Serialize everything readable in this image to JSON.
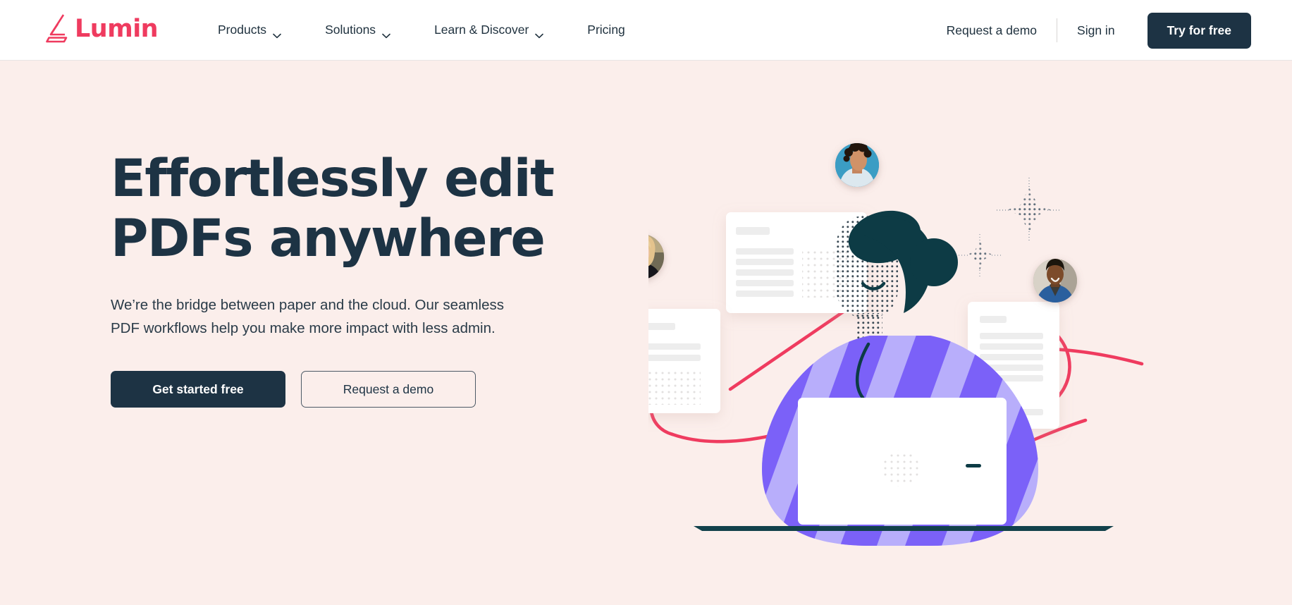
{
  "navbar": {
    "brand": {
      "name": "Lumin",
      "icon": "lumin-logo-mark",
      "color": "#ef3b5f"
    },
    "links": [
      {
        "label": "Products",
        "has_dropdown": true,
        "icon": "chevron-down-icon"
      },
      {
        "label": "Solutions",
        "has_dropdown": true,
        "icon": "chevron-down-icon"
      },
      {
        "label": "Learn & Discover",
        "has_dropdown": true,
        "icon": "chevron-down-icon"
      },
      {
        "label": "Pricing",
        "has_dropdown": false,
        "icon": ""
      }
    ],
    "request_demo_label": "Request a demo",
    "sign_in_label": "Sign in",
    "try_free_label": "Try for free"
  },
  "hero": {
    "title_line1": "Effortlessly edit",
    "title_line2": "PDFs anywhere",
    "subtitle": "We’re the bridge between paper and the cloud. Our seamless PDF workflows help you make more impact with less admin.",
    "primary_cta": "Get started free",
    "secondary_cta": "Request a demo",
    "background_color": "#fbeeeb",
    "text_color": "#1d3344"
  },
  "illustration": {
    "alt": "Person at laptop surrounded by floating PDF documents and collaborator avatars connected by pink lines",
    "accent_line_color": "#ef3b5f",
    "dark_color": "#0d3b45",
    "sweater_colors": [
      "#7b61f8",
      "#b8aefb"
    ],
    "documents": [
      {
        "name": "document-card-top",
        "orientation": "landscape"
      },
      {
        "name": "document-card-left",
        "orientation": "portrait"
      },
      {
        "name": "document-card-right",
        "orientation": "portrait"
      }
    ],
    "avatars": [
      {
        "name": "avatar-top",
        "background": "#3b9dc4"
      },
      {
        "name": "avatar-left",
        "background": "#8a7f6e"
      },
      {
        "name": "avatar-right",
        "background": "#b9b0a4"
      }
    ],
    "sparkles": [
      {
        "name": "sparkle-large"
      },
      {
        "name": "sparkle-small"
      }
    ]
  }
}
